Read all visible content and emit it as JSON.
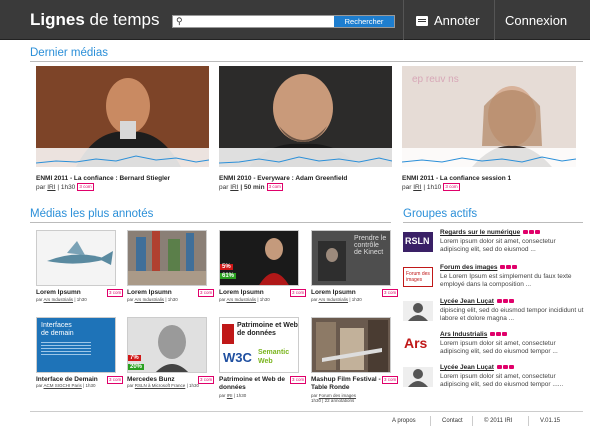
{
  "header": {
    "logo_bold": "Lignes",
    "logo_rest": " de temps",
    "search_placeholder": "",
    "search_button": "Rechercher",
    "annoter": "Annoter",
    "connexion": "Connexion"
  },
  "sections": {
    "latest": "Dernier médias",
    "most_annotated": "Médias les plus annotés",
    "groups": "Groupes actifs"
  },
  "latest_media": [
    {
      "title": "ENMI 2011 - La confiance : Bernard Stiegler",
      "par": "par",
      "author": "IRI",
      "duration": "| 1h30",
      "badge": "3 com"
    },
    {
      "title": "ENMI 2010 - Everyware : Adam Greenfield",
      "par": "par",
      "author": "IRI",
      "duration": "| 50 min",
      "badge": "3 com"
    },
    {
      "title": "ENMI 2011 - La confiance session 1",
      "par": "par",
      "author": "IRI",
      "duration": "| 1h10",
      "badge": "3 com"
    }
  ],
  "annotated_media": [
    {
      "title": "Lorem Ipsumn",
      "meta_par": "par",
      "meta_author": "Ars Industrialis",
      "meta_rest": "| 1h30",
      "badge": "3 com",
      "pct": ""
    },
    {
      "title": "Lorem Ipsumn",
      "meta_par": "par",
      "meta_author": "Ars Industrialis",
      "meta_rest": "| 1h30",
      "badge": "3 com",
      "pct": ""
    },
    {
      "title": "Lorem Ipsumn",
      "meta_par": "par",
      "meta_author": "Ars Industrialis",
      "meta_rest": "| 1h30",
      "badge": "3 com",
      "pct_red": "5%",
      "pct_green": "61%"
    },
    {
      "title": "Lorem Ipsumn",
      "meta_par": "par",
      "meta_author": "Ars Industrialis",
      "meta_rest": "| 1h30",
      "badge": "3 com",
      "pct": "",
      "thumb_text1": "Prendre le",
      "thumb_text2": "contrôle",
      "thumb_text3": "de Kinect"
    },
    {
      "title": "Interface de Demain",
      "meta_par": "par",
      "meta_author": "ACM SIGCHI Paris",
      "meta_rest": "| 1h30",
      "badge": "3 com",
      "thumb_text1": "Interfaces",
      "thumb_text2": "de demain"
    },
    {
      "title": "Mercedes Bunz",
      "meta_par": "par",
      "meta_author": "RSLN à Microsoft France",
      "meta_rest": "| 1h30",
      "badge": "3 com",
      "pct_red": "7%",
      "pct_green": "20%"
    },
    {
      "title": "Patrimoine et Web de données",
      "meta_par": "par",
      "meta_author": "IRI",
      "meta_rest": "| 1h30",
      "badge": "3 com",
      "thumb_text1": "Patrimoine et Web",
      "thumb_text2": "de données",
      "thumb_text3": "Semantic",
      "thumb_text4": "Web"
    },
    {
      "title": "Mashup Film Festival - Table Ronde",
      "meta_par": "par",
      "meta_author": "Forum des images",
      "meta_rest": "1h30 | 22 annotations",
      "badge": "3 com"
    }
  ],
  "groups": [
    {
      "name": "Regards sur le numérique",
      "desc": "Lorem ipsum dolor sit amet, consectetur adipiscing elit, sed do eiusmod ...",
      "logo": "RSLN"
    },
    {
      "name": "Forum des images",
      "desc": "Le Lorem Ipsum est simplement du faux texte employé dans la composition ...",
      "logo": "Forum des images"
    },
    {
      "name": "Lycée Jean Luçat",
      "desc": "dipiscing elit, sed do eiusmod tempor incididunt ut labore et dolore magna ...",
      "logo": ""
    },
    {
      "name": "Ars Industrialis",
      "desc": "Lorem ipsum dolor sit amet, consectetur adipiscing elit, sed do eiusmod tempor ...",
      "logo": "Ars"
    },
    {
      "name": "Lycée Jean Luçat",
      "desc": "Lorem ipsum dolor sit amet, consectetur adipiscing elit, sed do eiusmod tempor ......",
      "logo": ""
    }
  ],
  "footer": {
    "apropos": "A propos",
    "contact": "Contact",
    "copyright": "© 2011 IRI",
    "version": "V.01.15"
  },
  "colors": {
    "accent": "#2b8fd8",
    "header_bg": "#3a3a3a",
    "badge": "#e0006a",
    "search_button": "#1e7ecf"
  }
}
